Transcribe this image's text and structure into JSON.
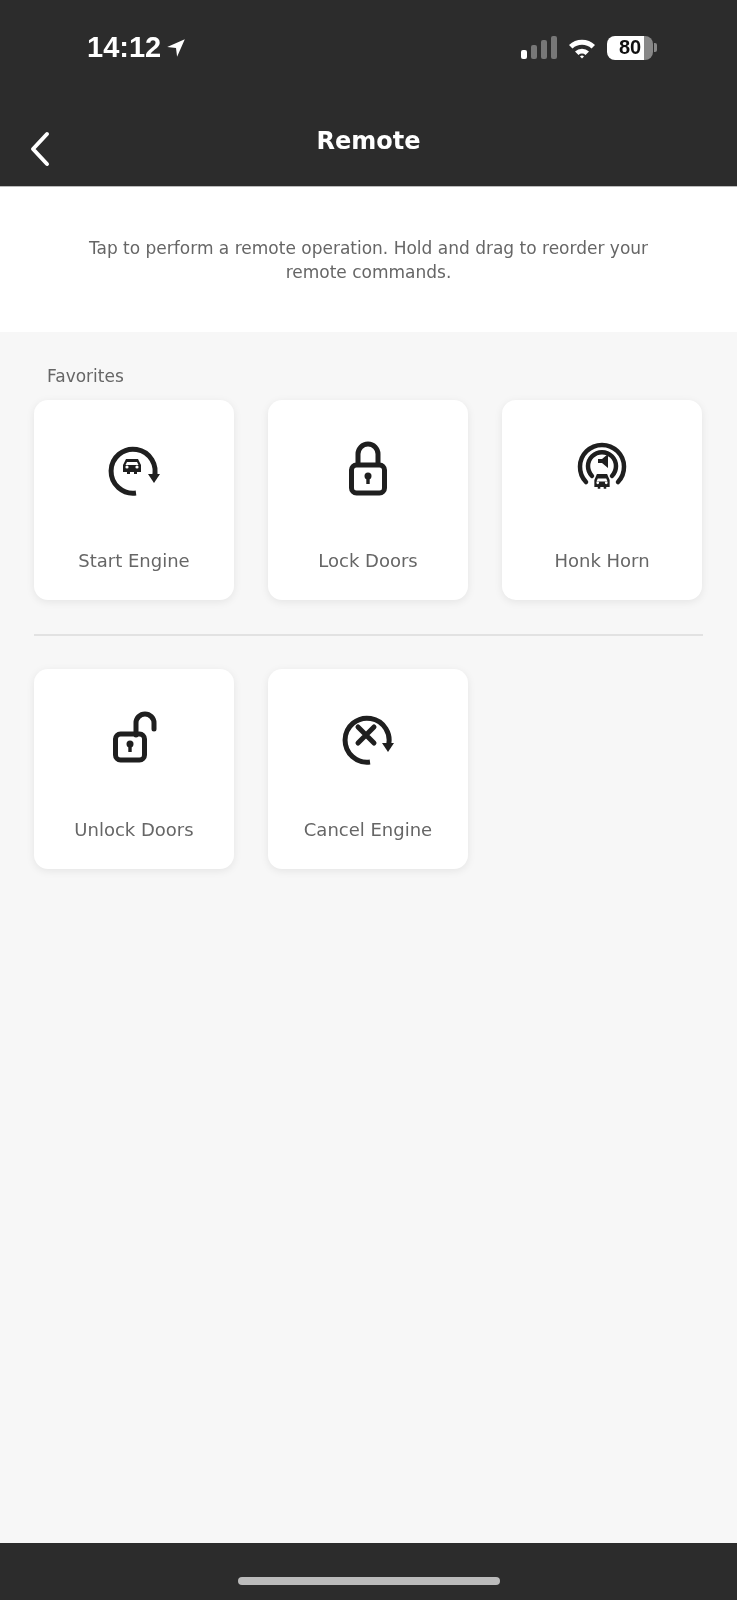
{
  "status_bar": {
    "time": "14:12",
    "battery": "80"
  },
  "nav": {
    "title": "Remote"
  },
  "intro": "Tap to perform a remote operation. Hold and drag to reorder your remote commands.",
  "groups": [
    {
      "label": "Favorites",
      "commands": [
        {
          "label": "Start Engine",
          "kind": "start"
        },
        {
          "label": "Lock Doors",
          "kind": "lock"
        },
        {
          "label": "Honk Horn",
          "kind": "horn"
        }
      ]
    },
    {
      "commands": [
        {
          "label": "Unlock Doors",
          "kind": "unlock"
        },
        {
          "label": "Cancel Engine",
          "kind": "cancel"
        }
      ]
    }
  ]
}
